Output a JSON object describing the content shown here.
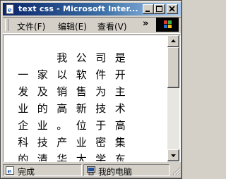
{
  "window": {
    "title": "text css - Microsoft Inter..."
  },
  "menu": {
    "items": [
      "文件(F)",
      "编辑(E)",
      "查看(V)"
    ],
    "overflow": "»"
  },
  "content": {
    "rows": [
      [
        "",
        "",
        "我",
        "公",
        "司",
        "是"
      ],
      [
        "一",
        "家",
        "以",
        "软",
        "件",
        "开"
      ],
      [
        "发",
        "及",
        "销",
        "售",
        "为",
        "主"
      ],
      [
        "业",
        "的",
        "高",
        "新",
        "技",
        "术"
      ],
      [
        "企",
        "业",
        "。",
        "位",
        "于",
        "高"
      ],
      [
        "科",
        "技",
        "产",
        "业",
        "密",
        "集"
      ],
      [
        "的",
        "清",
        "华",
        "大",
        "学",
        "东"
      ]
    ]
  },
  "status": {
    "left": "完成",
    "zone": "我的电脑"
  },
  "colors": {
    "titlebar_start": "#0a246a",
    "titlebar_end": "#a6caf0",
    "chrome": "#d4d0c8"
  }
}
